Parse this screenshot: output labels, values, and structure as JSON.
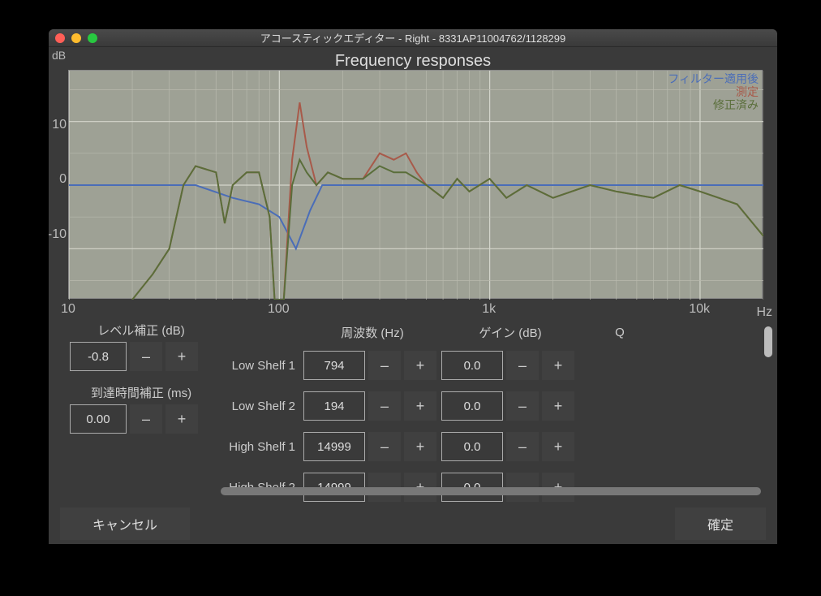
{
  "window": {
    "title": "アコースティックエディター - Right - 8331AP11004762/1128299"
  },
  "axis": {
    "y_label": "dB",
    "x_label": "Hz",
    "chart_title": "Frequency responses",
    "y_ticks": [
      "10",
      "0",
      "-10"
    ],
    "x_ticks": [
      "10",
      "100",
      "1k",
      "10k"
    ]
  },
  "legend": {
    "filtered": "フィルター適用後",
    "measured": "測定",
    "corrected": "修正済み"
  },
  "level": {
    "label": "レベル補正 (dB)",
    "value": "-0.8"
  },
  "arrival": {
    "label": "到達時間補正 (ms)",
    "value": "0.00"
  },
  "headers": {
    "freq": "周波数 (Hz)",
    "gain": "ゲイン (dB)",
    "q": "Q"
  },
  "bands": [
    {
      "name": "Low Shelf 1",
      "freq": "794",
      "gain": "0.0"
    },
    {
      "name": "Low Shelf 2",
      "freq": "194",
      "gain": "0.0"
    },
    {
      "name": "High Shelf 1",
      "freq": "14999",
      "gain": "0.0"
    },
    {
      "name": "High Shelf 2",
      "freq": "14999",
      "gain": "0.0"
    }
  ],
  "buttons": {
    "minus": "–",
    "plus": "+",
    "cancel": "キャンセル",
    "confirm": "確定"
  },
  "chart_data": {
    "type": "line",
    "title": "Frequency responses",
    "xlabel": "Hz",
    "ylabel": "dB",
    "x_scale": "log",
    "xlim": [
      10,
      20000
    ],
    "ylim": [
      -18,
      18
    ],
    "legend_position": "top-right",
    "grid": true,
    "series": [
      {
        "name": "フィルター適用後",
        "color": "#4a6db8",
        "points": [
          [
            10,
            0
          ],
          [
            40,
            0
          ],
          [
            60,
            -2
          ],
          [
            80,
            -3
          ],
          [
            100,
            -5
          ],
          [
            120,
            -10
          ],
          [
            140,
            -4
          ],
          [
            160,
            0
          ],
          [
            300,
            0
          ],
          [
            500,
            0
          ],
          [
            1000,
            0
          ],
          [
            2000,
            0
          ],
          [
            5000,
            0
          ],
          [
            10000,
            0
          ],
          [
            20000,
            0
          ]
        ]
      },
      {
        "name": "測定",
        "color": "#a85a4a",
        "points": [
          [
            20,
            -18
          ],
          [
            25,
            -14
          ],
          [
            30,
            -10
          ],
          [
            35,
            0
          ],
          [
            40,
            3
          ],
          [
            50,
            2
          ],
          [
            55,
            -6
          ],
          [
            60,
            0
          ],
          [
            70,
            2
          ],
          [
            80,
            2
          ],
          [
            90,
            -5
          ],
          [
            95,
            -18
          ],
          [
            105,
            -18
          ],
          [
            115,
            4
          ],
          [
            125,
            13
          ],
          [
            135,
            6
          ],
          [
            150,
            0
          ],
          [
            170,
            2
          ],
          [
            200,
            1
          ],
          [
            250,
            1
          ],
          [
            300,
            5
          ],
          [
            350,
            4
          ],
          [
            400,
            5
          ],
          [
            450,
            2
          ],
          [
            500,
            0
          ],
          [
            600,
            -2
          ],
          [
            700,
            1
          ],
          [
            800,
            -1
          ],
          [
            1000,
            1
          ],
          [
            1200,
            -2
          ],
          [
            1500,
            0
          ],
          [
            2000,
            -2
          ],
          [
            3000,
            0
          ],
          [
            4000,
            -1
          ],
          [
            6000,
            -2
          ],
          [
            8000,
            0
          ],
          [
            10000,
            -1
          ],
          [
            15000,
            -3
          ],
          [
            20000,
            -8
          ]
        ]
      },
      {
        "name": "修正済み",
        "color": "#5a6e3a",
        "points": [
          [
            20,
            -18
          ],
          [
            25,
            -14
          ],
          [
            30,
            -10
          ],
          [
            35,
            0
          ],
          [
            40,
            3
          ],
          [
            50,
            2
          ],
          [
            55,
            -6
          ],
          [
            60,
            0
          ],
          [
            70,
            2
          ],
          [
            80,
            2
          ],
          [
            90,
            -5
          ],
          [
            95,
            -18
          ],
          [
            105,
            -18
          ],
          [
            115,
            0
          ],
          [
            125,
            4
          ],
          [
            135,
            2
          ],
          [
            150,
            0
          ],
          [
            170,
            2
          ],
          [
            200,
            1
          ],
          [
            250,
            1
          ],
          [
            300,
            3
          ],
          [
            350,
            2
          ],
          [
            400,
            2
          ],
          [
            450,
            1
          ],
          [
            500,
            0
          ],
          [
            600,
            -2
          ],
          [
            700,
            1
          ],
          [
            800,
            -1
          ],
          [
            1000,
            1
          ],
          [
            1200,
            -2
          ],
          [
            1500,
            0
          ],
          [
            2000,
            -2
          ],
          [
            3000,
            0
          ],
          [
            4000,
            -1
          ],
          [
            6000,
            -2
          ],
          [
            8000,
            0
          ],
          [
            10000,
            -1
          ],
          [
            15000,
            -3
          ],
          [
            20000,
            -8
          ]
        ]
      }
    ]
  }
}
